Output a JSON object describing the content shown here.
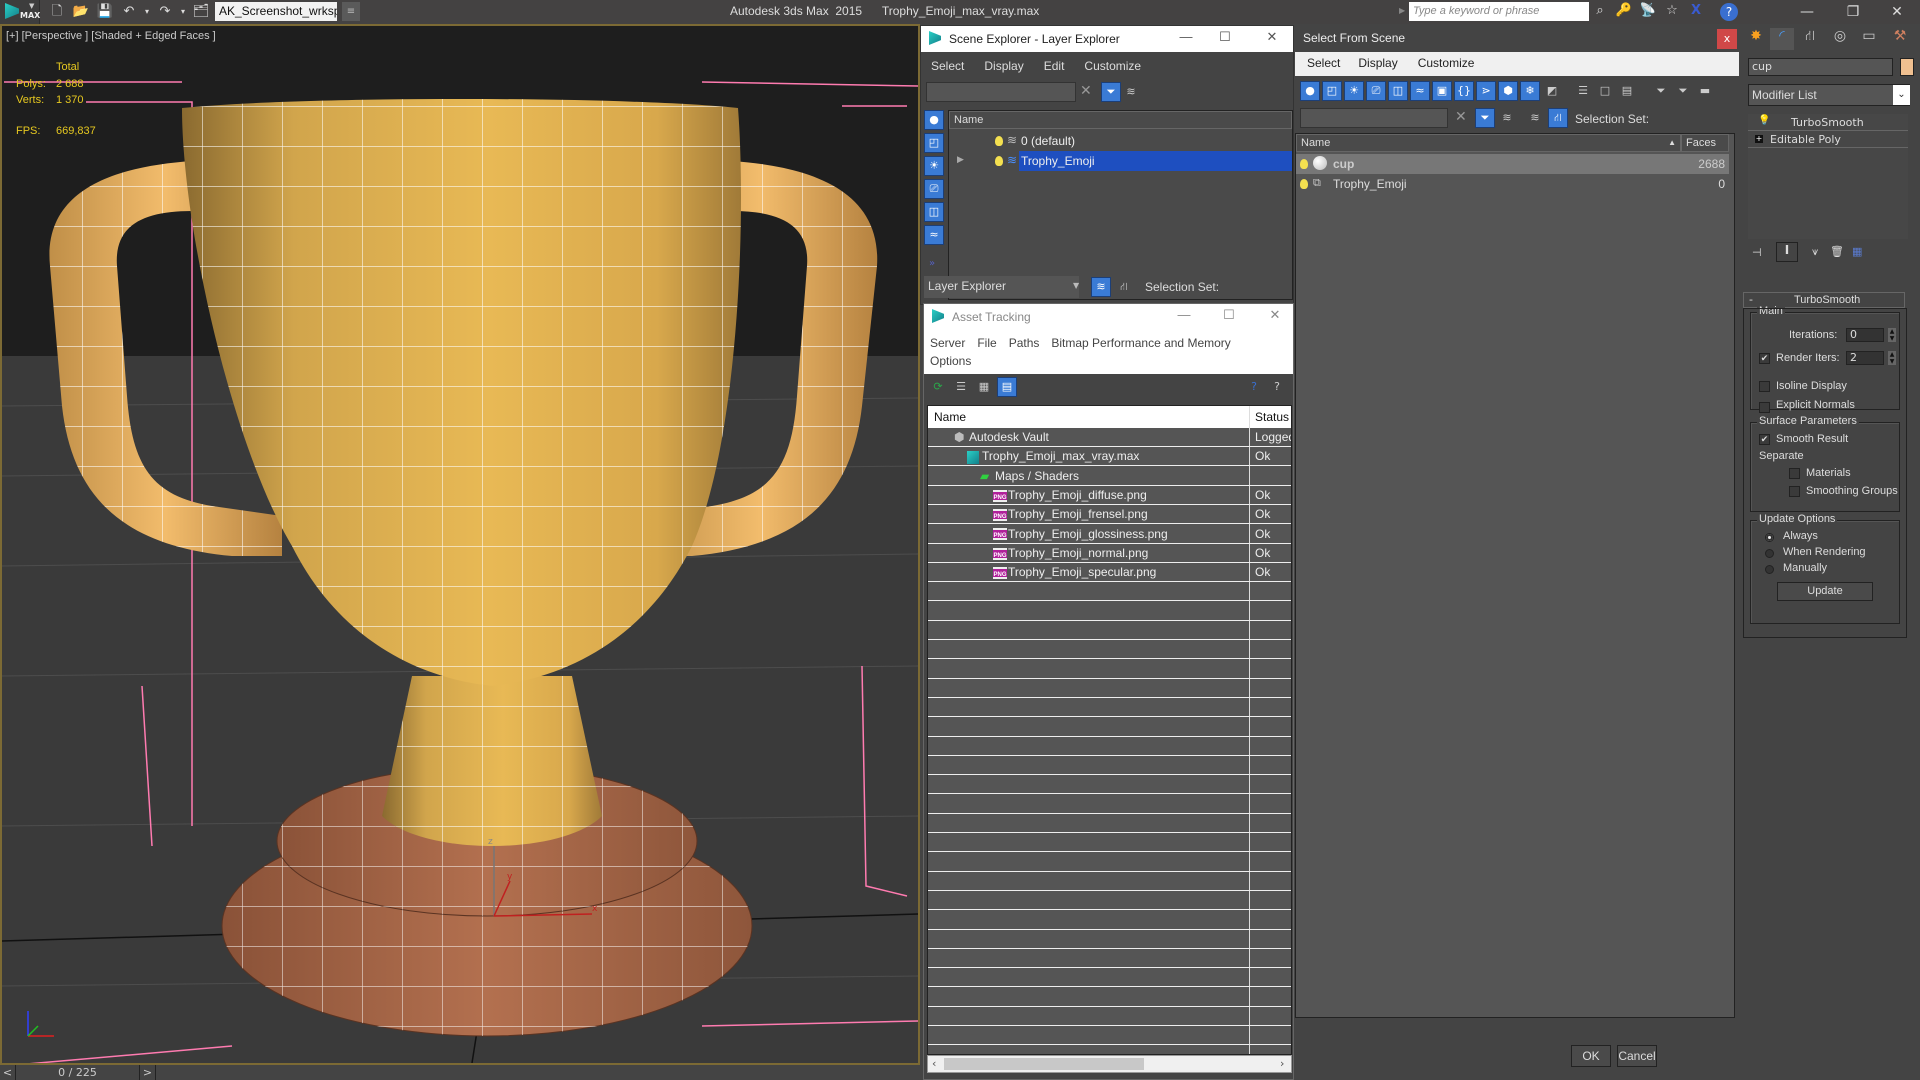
{
  "titlebar": {
    "app_title": "Autodesk 3ds Max  2015      Trophy_Emoji_max_vray.max",
    "workspace": "AK_Screenshot_wrksp",
    "search_placeholder": "Type a keyword or phrase",
    "logo_text": "MAX"
  },
  "viewport": {
    "label": "[+] [Perspective ] [Shaded + Edged Faces ]",
    "stats": {
      "total_label": "Total",
      "polys_label": "Polys:",
      "polys_value": "2 688",
      "verts_label": "Verts:",
      "verts_value": "1 370",
      "fps_label": "FPS:",
      "fps_value": "669,837"
    },
    "axis": {
      "x": "x",
      "y": "y",
      "z": "z"
    },
    "colors": {
      "cup": "#e8b455",
      "base": "#b06c4e",
      "grid_pink": "#ff7bb0",
      "frame": "#7c6a34"
    }
  },
  "timeline": {
    "prev": "<",
    "frame": "0 / 225",
    "next": ">"
  },
  "scene_explorer": {
    "title": "Scene Explorer - Layer Explorer",
    "menu": [
      "Select",
      "Display",
      "Edit",
      "Customize"
    ],
    "column": "Name",
    "rows": [
      {
        "name": "0 (default)",
        "selected": false
      },
      {
        "name": "Trophy_Emoji",
        "selected": true
      }
    ],
    "footer_mode": "Layer Explorer",
    "selection_set_label": "Selection Set:"
  },
  "asset_tracking": {
    "title": "Asset Tracking",
    "menu": [
      "Server",
      "File",
      "Paths",
      "Bitmap Performance and Memory",
      "Options"
    ],
    "columns": [
      "Name",
      "Status"
    ],
    "rows": [
      {
        "name": "Autodesk Vault",
        "status": "Logged",
        "indent": 0,
        "icon": "vault-icon"
      },
      {
        "name": "Trophy_Emoji_max_vray.max",
        "status": "Ok",
        "indent": 1,
        "icon": "max-file-icon"
      },
      {
        "name": "Maps / Shaders",
        "status": "",
        "indent": 2,
        "icon": "maps-icon"
      },
      {
        "name": "Trophy_Emoji_diffuse.png",
        "status": "Ok",
        "indent": 3,
        "icon": "png-icon"
      },
      {
        "name": "Trophy_Emoji_frensel.png",
        "status": "Ok",
        "indent": 3,
        "icon": "png-icon"
      },
      {
        "name": "Trophy_Emoji_glossiness.png",
        "status": "Ok",
        "indent": 3,
        "icon": "png-icon"
      },
      {
        "name": "Trophy_Emoji_normal.png",
        "status": "Ok",
        "indent": 3,
        "icon": "png-icon"
      },
      {
        "name": "Trophy_Emoji_specular.png",
        "status": "Ok",
        "indent": 3,
        "icon": "png-icon"
      }
    ],
    "png_badge": "PNG"
  },
  "select_from_scene": {
    "title": "Select From Scene",
    "menu": [
      "Select",
      "Display",
      "Customize"
    ],
    "selection_set_label": "Selection Set:",
    "columns": [
      "Name",
      "Faces"
    ],
    "rows": [
      {
        "name": "cup",
        "faces": "2688",
        "selected": true
      },
      {
        "name": "Trophy_Emoji",
        "faces": "0",
        "selected": false
      }
    ],
    "ok": "OK",
    "cancel": "Cancel"
  },
  "command_panel": {
    "object_name": "cup",
    "object_color": "#f0c090",
    "modifier_list": "Modifier List",
    "stack": [
      "TurboSmooth",
      "Editable Poly"
    ],
    "rollout_title": "TurboSmooth",
    "main_group": "Main",
    "iterations_label": "Iterations:",
    "iterations_value": "0",
    "render_iters_label": "Render Iters:",
    "render_iters_value": "2",
    "render_iters_checked": true,
    "isoline_label": "Isoline Display",
    "isoline_checked": false,
    "explicit_normals_label": "Explicit Normals",
    "explicit_normals_checked": false,
    "surface_group": "Surface Parameters",
    "smooth_result_label": "Smooth Result",
    "smooth_result_checked": true,
    "separate_label": "Separate",
    "materials_label": "Materials",
    "smoothing_groups_label": "Smoothing Groups",
    "update_group": "Update Options",
    "update_options": [
      "Always",
      "When Rendering",
      "Manually"
    ],
    "update_selected": "Always",
    "update_button": "Update"
  }
}
